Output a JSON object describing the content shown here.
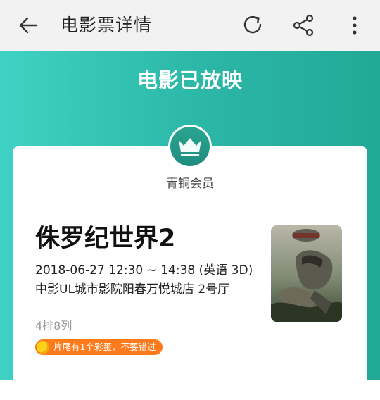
{
  "app_bar": {
    "title": "电影票详情",
    "back_icon": "arrow-left-icon",
    "refresh_icon": "refresh-icon",
    "share_icon": "share-icon",
    "more_icon": "more-vertical-icon"
  },
  "status": {
    "headline": "电影已放映"
  },
  "member": {
    "badge_icon": "crown-icon",
    "level": "青铜会员"
  },
  "ticket": {
    "movie_title": "侏罗纪世界2",
    "showtime": "2018-06-27 12:30 ~ 14:38 (英语 3D)",
    "cinema": "中影UL城市影院阳春万悦城店 2号厅",
    "seat": "4排8列",
    "easter_egg_tip": "片尾有1个彩蛋，不要错过",
    "easter_egg_icon": "egg-icon"
  },
  "poster": {
    "alt": "Jurassic World poster"
  },
  "colors": {
    "appbar_bg": "#f2f2f2",
    "hero_start": "#3fd2c3",
    "hero_end": "#22a996",
    "badge": "#1f8d7e",
    "egg_pill": "#ff7a1a"
  }
}
